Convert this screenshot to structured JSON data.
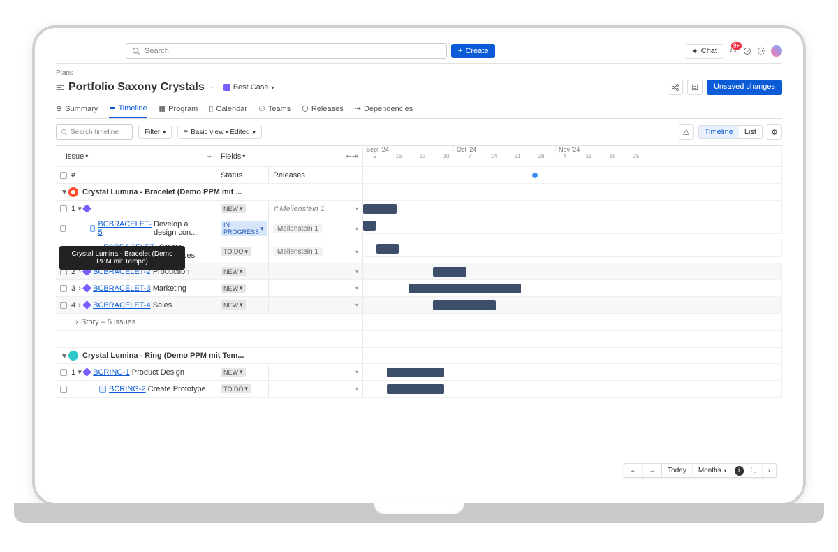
{
  "topbar": {
    "search_placeholder": "Search",
    "create_label": "Create",
    "chat_label": "Chat",
    "notif_badge": "9+"
  },
  "breadcrumb": "Plans",
  "page_title": "Portfolio Saxony Crystals",
  "scenario": "Best Case",
  "unsaved_label": "Unsaved changes",
  "tabs": [
    "Summary",
    "Timeline",
    "Program",
    "Calendar",
    "Teams",
    "Releases",
    "Dependencies"
  ],
  "toolbar": {
    "search_placeholder": "Search timeline",
    "filter_label": "Filter",
    "view_label": "Basic view • Edited",
    "timeline_label": "Timeline",
    "list_label": "List"
  },
  "columns": {
    "issue": "Issue",
    "fields": "Fields",
    "hash": "#",
    "status": "Status",
    "releases": "Releases"
  },
  "months": [
    "Sept '24",
    "Oct '24",
    "Nov '24"
  ],
  "days": [
    9,
    16,
    23,
    30,
    7,
    14,
    21,
    28,
    4,
    11,
    18,
    25
  ],
  "project1": {
    "name": "Crystal Lumina - Bracelet (Demo PPM mit ...",
    "tooltip": "Crystal Lumina - Bracelet (Demo PPM mit Tempo)"
  },
  "project2": {
    "name": "Crystal Lumina - Ring (Demo PPM mit Tem..."
  },
  "rows": [
    {
      "idx": "1",
      "key": "",
      "title": "",
      "status": "NEW",
      "release": "Meilenstein 1",
      "release_ital": true,
      "bar": [
        0,
        48
      ],
      "alt": false,
      "indent": 1,
      "epic": true
    },
    {
      "idx": "",
      "key": "BCBRACELET-5",
      "title": "Develop a design con...",
      "status": "IN PROGRESS",
      "release": "Meilenstein 1",
      "bar": [
        0,
        18
      ],
      "alt": false,
      "indent": 2
    },
    {
      "idx": "",
      "key": "BCBRACELET-6",
      "title": "Create prototypes",
      "status": "TO DO",
      "release": "Meilenstein 1",
      "bar": [
        19,
        32
      ],
      "alt": false,
      "indent": 2
    },
    {
      "idx": "2",
      "key": "BCBRACELET-2",
      "title": "Production",
      "status": "NEW",
      "release": "",
      "bar": [
        100,
        148
      ],
      "alt": true,
      "indent": 1,
      "epic": true
    },
    {
      "idx": "3",
      "key": "BCBRACELET-3",
      "title": "Marketing",
      "status": "NEW",
      "release": "",
      "bar": [
        66,
        226
      ],
      "alt": false,
      "indent": 1,
      "epic": true
    },
    {
      "idx": "4",
      "key": "BCBRACELET-4",
      "title": "Sales",
      "status": "NEW",
      "release": "",
      "bar": [
        100,
        190
      ],
      "alt": true,
      "indent": 1,
      "epic": true
    },
    {
      "story": "Story – 5 issues"
    }
  ],
  "rows2": [
    {
      "idx": "1",
      "key": "BCRING-1",
      "title": "Product Design",
      "status": "NEW",
      "release": "",
      "bar": [
        34,
        116
      ],
      "alt": false,
      "indent": 1,
      "epic": true
    },
    {
      "idx": "",
      "key": "BCRING-2",
      "title": "Create Prototype",
      "status": "TO DO",
      "release": "",
      "bar": [
        34,
        116
      ],
      "alt": false,
      "indent": 2
    }
  ],
  "footer": {
    "today": "Today",
    "months": "Months"
  }
}
